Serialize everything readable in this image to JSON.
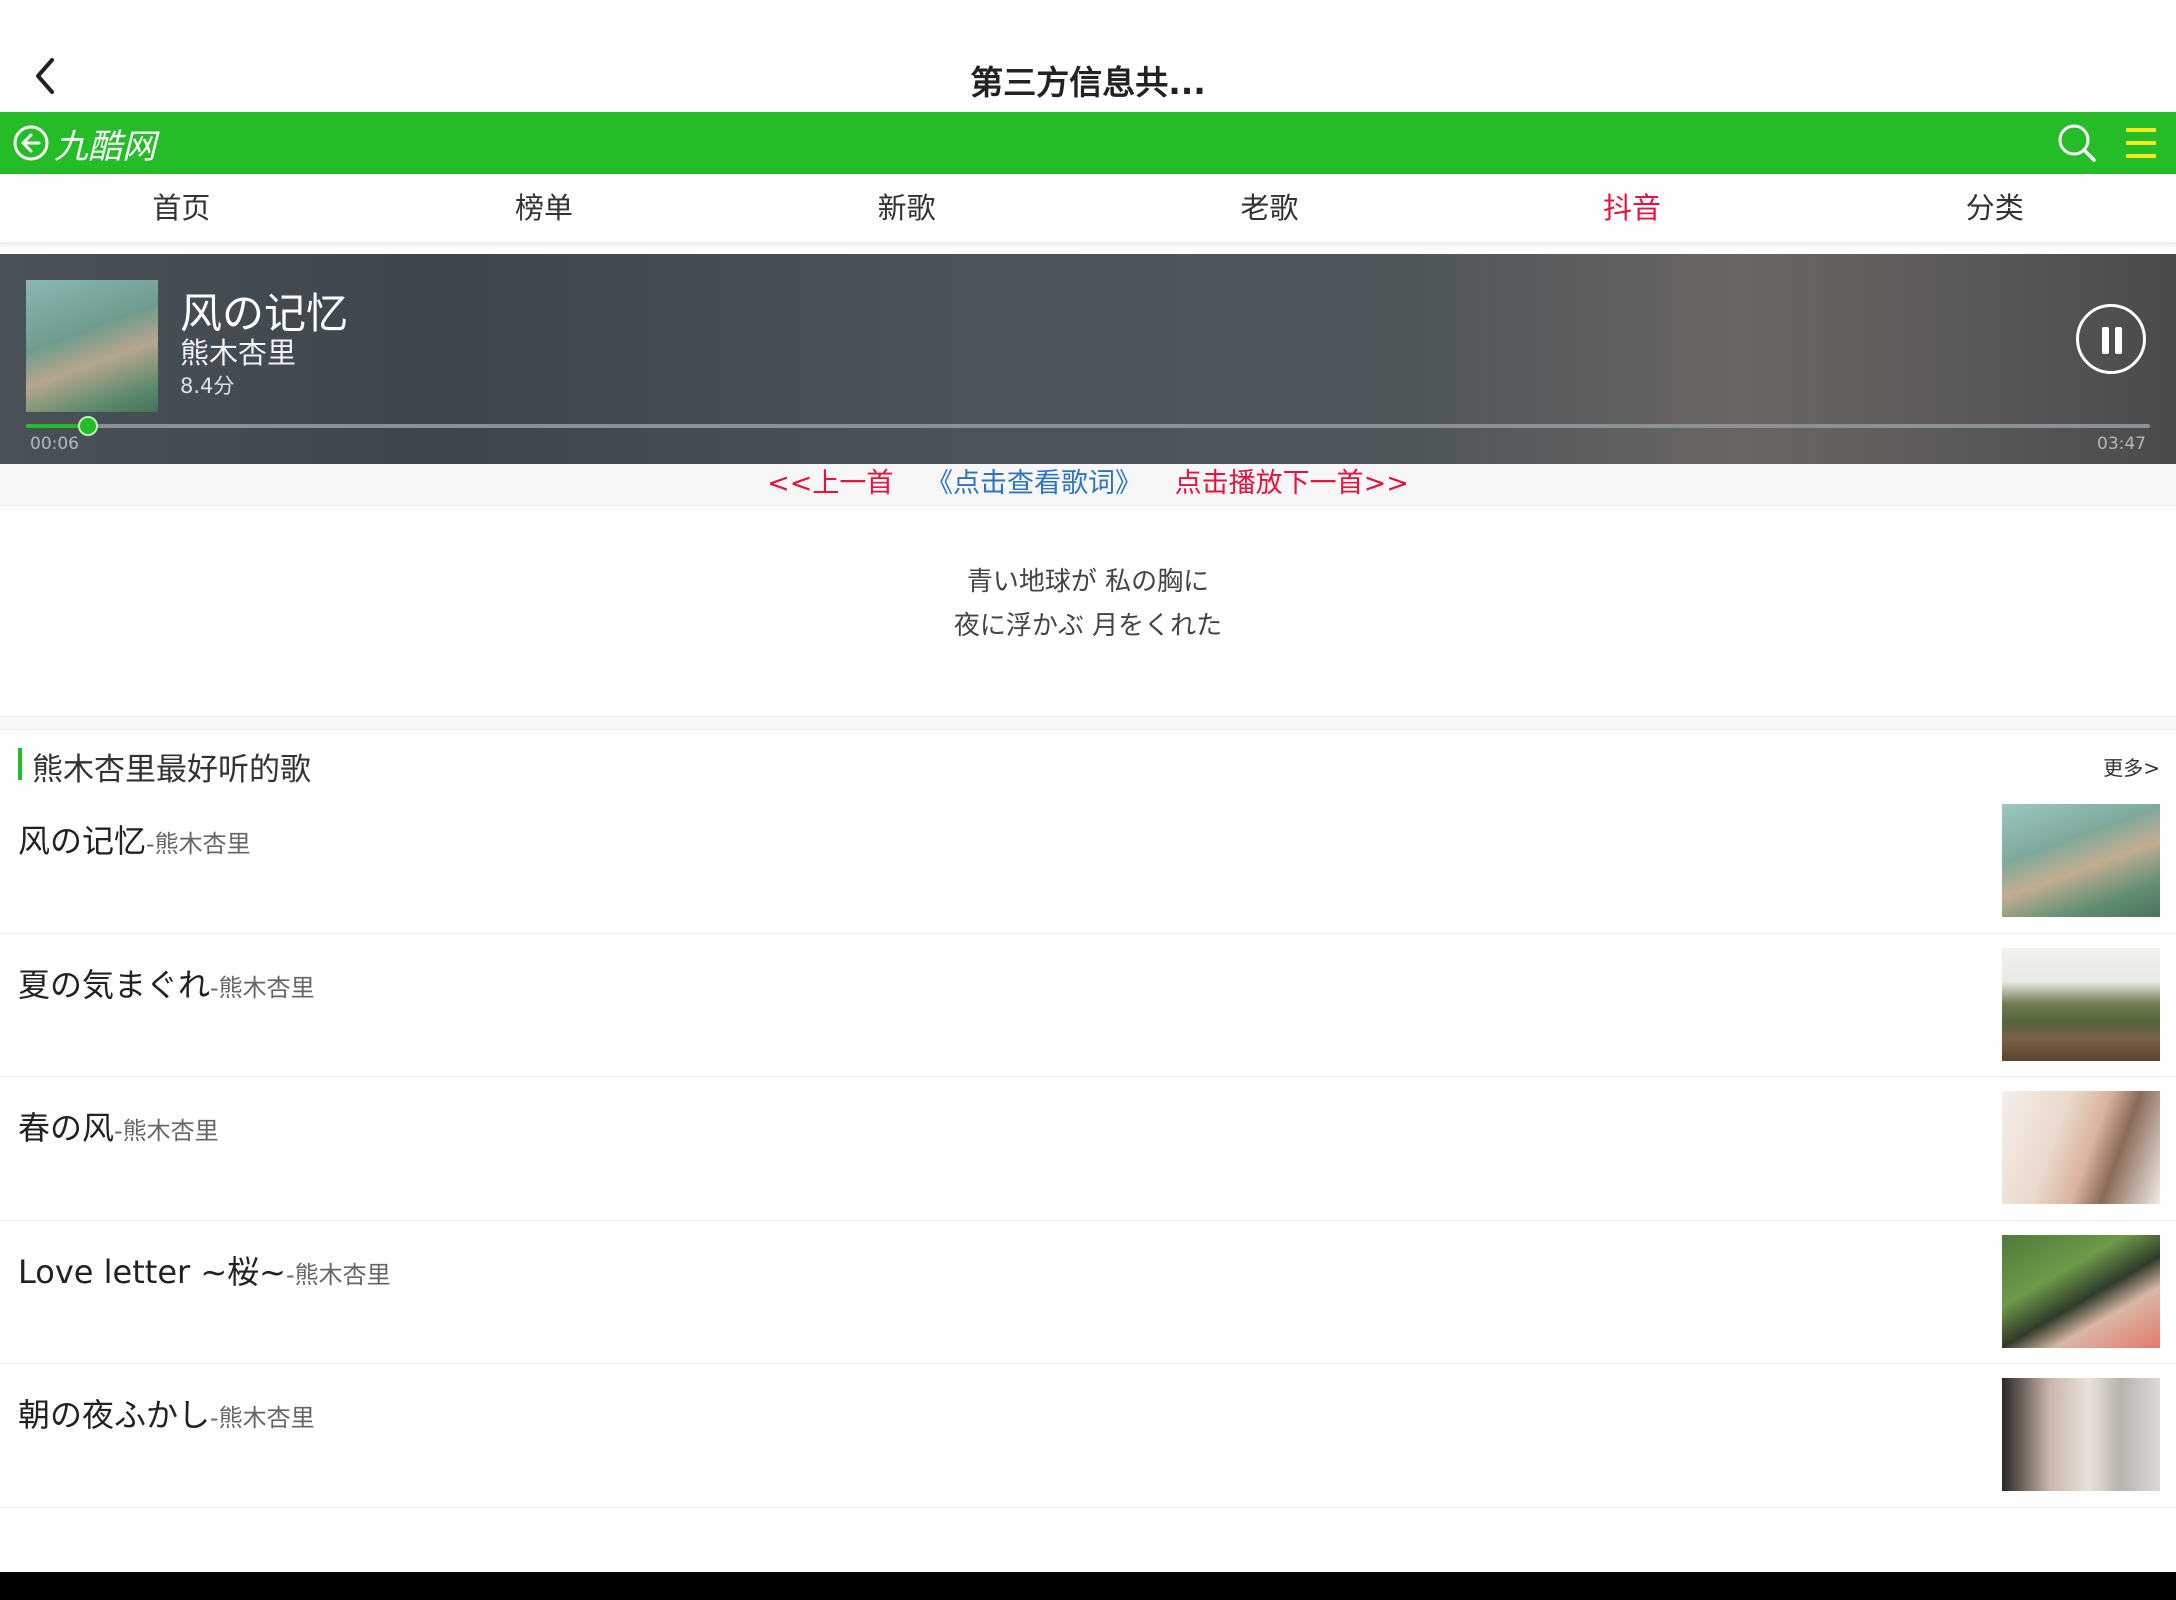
{
  "appbar": {
    "title": "第三方信息共..."
  },
  "site": {
    "logo_text": "九酷网",
    "colors": {
      "header": "#25bd27",
      "active_tab": "#e8123c",
      "link_red": "#e8123c",
      "link_blue": "#2f74c0"
    }
  },
  "nav": {
    "tabs": [
      {
        "label": "首页"
      },
      {
        "label": "榜单"
      },
      {
        "label": "新歌"
      },
      {
        "label": "老歌"
      },
      {
        "label": "抖音",
        "active": true
      },
      {
        "label": "分类"
      }
    ]
  },
  "player": {
    "title": "风の记忆",
    "artist": "熊木杏里",
    "score": "8.4分",
    "current_time": "00:06",
    "total_time": "03:47",
    "progress": 0.029,
    "state_icon": "pause-icon"
  },
  "controls": {
    "prev": "<<上一首",
    "lyrics": "《点击查看歌词》",
    "next": "点击播放下一首>>"
  },
  "lyrics": {
    "line1": "青い地球が 私の胸に",
    "line2": "夜に浮かぶ 月をくれた"
  },
  "section": {
    "title": "熊木杏里最好听的歌",
    "more": "更多>"
  },
  "songs": [
    {
      "title": "风の记忆",
      "artist": "-熊木杏里"
    },
    {
      "title": "夏の気まぐれ",
      "artist": "-熊木杏里"
    },
    {
      "title": "春の风",
      "artist": "-熊木杏里"
    },
    {
      "title": "Love letter ~桜~",
      "artist": "-熊木杏里"
    },
    {
      "title": "朝の夜ふかし",
      "artist": "-熊木杏里"
    }
  ]
}
